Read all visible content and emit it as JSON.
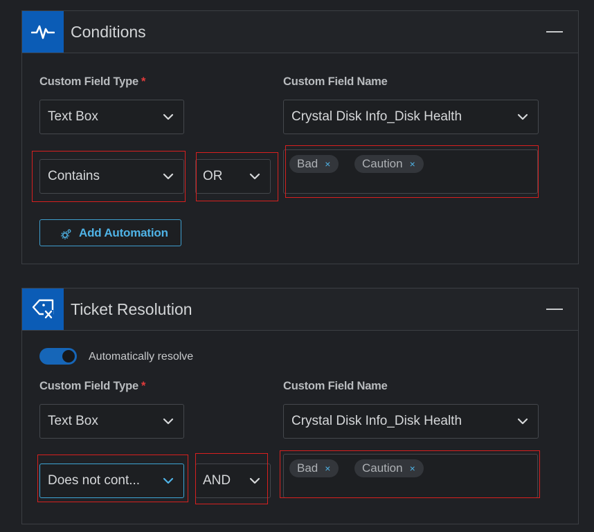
{
  "conditions": {
    "title": "Conditions",
    "icon": "activity-pulse-icon",
    "custom_field_type_label": "Custom Field Type",
    "required_marker": "*",
    "custom_field_name_label": "Custom Field Name",
    "custom_field_type_value": "Text Box",
    "custom_field_name_value": "Crystal Disk Info_Disk Health",
    "operator_value": "Contains",
    "logic_value": "OR",
    "tags": [
      {
        "label": "Bad",
        "remove": "×"
      },
      {
        "label": "Caution",
        "remove": "×"
      }
    ],
    "add_automation_label": "Add Automation"
  },
  "ticket_resolution": {
    "title": "Ticket Resolution",
    "icon": "ticket-tag-remove-icon",
    "toggle_label": "Automatically resolve",
    "toggle_on": true,
    "custom_field_type_label": "Custom Field Type",
    "required_marker": "*",
    "custom_field_name_label": "Custom Field Name",
    "custom_field_type_value": "Text Box",
    "custom_field_name_value": "Crystal Disk Info_Disk Health",
    "operator_value": "Does not cont...",
    "logic_value": "AND",
    "tags": [
      {
        "label": "Bad",
        "remove": "×"
      },
      {
        "label": "Caution",
        "remove": "×"
      }
    ]
  },
  "colors": {
    "accent_blue": "#0b5cb6",
    "link_blue": "#4fb3e6",
    "highlight_red": "#d9201f",
    "required_red": "#e23b3b"
  }
}
